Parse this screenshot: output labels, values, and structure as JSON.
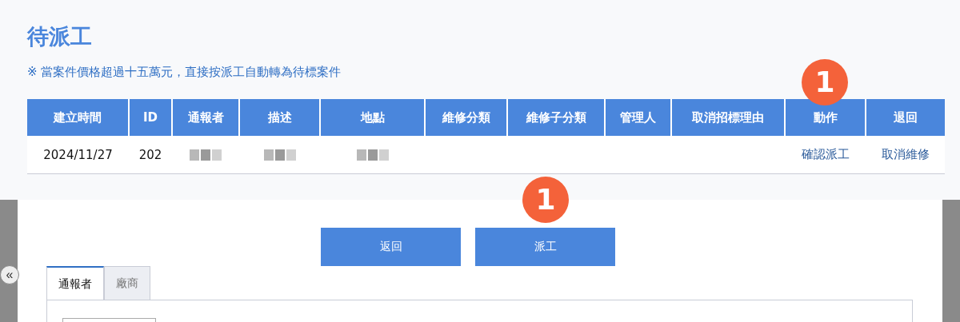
{
  "title": "待派工",
  "notice": "※ 當案件價格超過十五萬元，直接按派工自動轉為待標案件",
  "table": {
    "columns": [
      {
        "label": "建立時間"
      },
      {
        "label": "ID"
      },
      {
        "label": "通報者"
      },
      {
        "label": "描述"
      },
      {
        "label": "地點"
      },
      {
        "label": "維修分類"
      },
      {
        "label": "維修子分類"
      },
      {
        "label": "管理人"
      },
      {
        "label": "取消招標理由"
      },
      {
        "label": "動作",
        "badge": "1"
      },
      {
        "label": "退回"
      }
    ],
    "rows": [
      {
        "cells": [
          {
            "kind": "text",
            "text": "2024/11/27"
          },
          {
            "kind": "text",
            "text": "202"
          },
          {
            "kind": "redacted"
          },
          {
            "kind": "redacted"
          },
          {
            "kind": "redacted"
          },
          {
            "kind": "empty"
          },
          {
            "kind": "empty"
          },
          {
            "kind": "empty"
          },
          {
            "kind": "empty"
          },
          {
            "kind": "link",
            "text": "確認派工"
          },
          {
            "kind": "link",
            "text": "取消維修"
          }
        ]
      }
    ]
  },
  "buttons": [
    {
      "label": "返回"
    },
    {
      "label": "派工",
      "badge": "1"
    }
  ],
  "tabs": [
    {
      "label": "通報者",
      "selected": true
    },
    {
      "label": "廠商",
      "selected": false
    }
  ],
  "side_button": "«"
}
